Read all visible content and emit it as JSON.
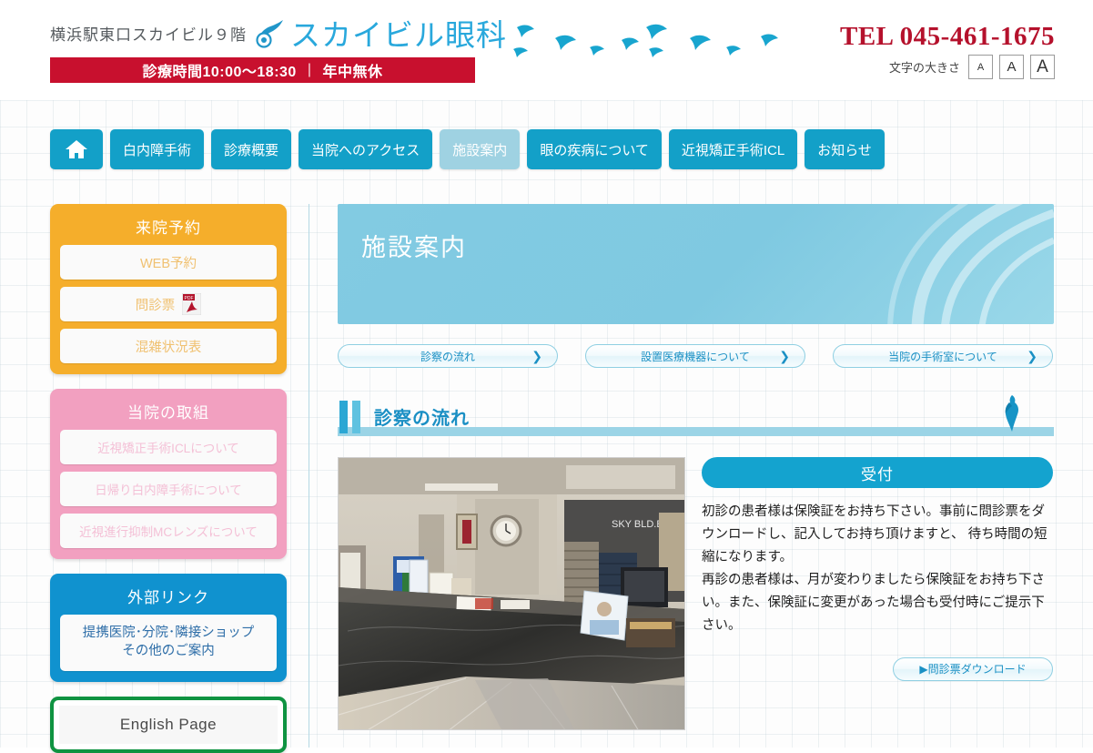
{
  "header": {
    "site_subtitle": "横浜駅東口スカイビル９階",
    "site_name": "スカイビル眼科",
    "hours_text": "診療時間10:00〜18:30",
    "hours_separator": "|",
    "holiday_text": "年中無休",
    "tel": "TEL 045-461-1675",
    "fontsize_label": "文字の大きさ",
    "fontsize_small": "A",
    "fontsize_medium": "A",
    "fontsize_large": "A"
  },
  "nav": {
    "home_icon": "home-icon",
    "items": [
      {
        "label": "白内障手術",
        "active": false
      },
      {
        "label": "診療概要",
        "active": false
      },
      {
        "label": "当院へのアクセス",
        "active": false
      },
      {
        "label": "施設案内",
        "active": true
      },
      {
        "label": "眼の疾病について",
        "active": false
      },
      {
        "label": "近視矯正手術ICL",
        "active": false
      },
      {
        "label": "お知らせ",
        "active": false
      }
    ]
  },
  "sidebar": {
    "reservation": {
      "title": "来院予約",
      "color": "#f5ae2b",
      "links": [
        {
          "label": "WEB予約",
          "pdf": false
        },
        {
          "label": "問診票",
          "pdf": true
        },
        {
          "label": "混雑状況表",
          "pdf": false
        }
      ]
    },
    "efforts": {
      "title": "当院の取組",
      "color": "#f2a0c0",
      "links": [
        {
          "label": "近視矯正手術ICLについて"
        },
        {
          "label": "日帰り白内障手術について"
        },
        {
          "label": "近視進行抑制MCレンズについて"
        }
      ]
    },
    "external": {
      "title": "外部リンク",
      "color": "#1092cf",
      "link_line1": "提携医院･分院･隣接ショップ",
      "link_line2": "その他のご案内"
    },
    "english": {
      "label": "English Page",
      "color": "#0f9341"
    }
  },
  "main": {
    "page_title": "施設案内",
    "subnav": [
      {
        "label": "診察の流れ",
        "chevron": "❯"
      },
      {
        "label": "設置医療機器について",
        "chevron": "❯"
      },
      {
        "label": "当院の手術室について",
        "chevron": "❯"
      }
    ],
    "section": {
      "title": "診察の流れ",
      "photo_alt": "受付カウンターの写真",
      "reception_heading": "受付",
      "paragraph1": "初診の患者様は保険証をお持ち下さい。事前に問診票をダウンロードし、記入してお持ち頂けますと、 待ち時間の短縮になります。",
      "paragraph2": "再診の患者様は、月が変わりましたら保険証をお持ち下さい。また、保険証に変更があった場合も受付時にご提示下さい。",
      "download_label": "▶問診票ダウンロード"
    }
  },
  "colors": {
    "accent_blue": "#13a0c8",
    "banner_blue": "#82cbe2",
    "red": "#c8102e",
    "tel_red": "#b5112c",
    "orange": "#f5ae2b",
    "pink": "#f2a0c0",
    "green": "#0f9341"
  }
}
